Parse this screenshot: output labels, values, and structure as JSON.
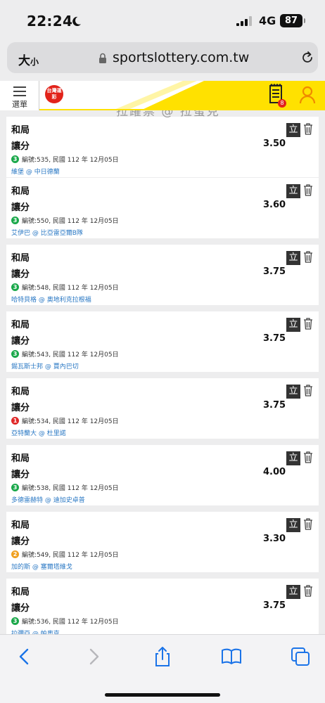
{
  "status_bar": {
    "time": "22:24",
    "network": "4G",
    "battery": "87"
  },
  "address_bar": {
    "text_size_big": "大",
    "text_size_small": "小",
    "url": "sportslottery.com.tw"
  },
  "header": {
    "menu_label": "選單",
    "logo_text": "台灣運彩",
    "bets_count": "8",
    "page_title_peek": "拉躍票 @ 拉蜜克"
  },
  "colors": {
    "accent_yellow": "#ffe100",
    "brand_red": "#e2231a",
    "link_blue": "#2a78c4",
    "badge_green": "#1aa84a",
    "badge_red": "#e02929",
    "badge_orange": "#f0a020"
  },
  "cards": [
    {
      "title": "和局",
      "bet_type": "讓分",
      "odds": "3.50",
      "badge": "3",
      "badge_color": "green",
      "meta": "編號:535, 民國 112 年 12月05日",
      "match": "維堡 @ 中日德蘭",
      "stand_label": "立"
    },
    {
      "title": "和局",
      "bet_type": "讓分",
      "odds": "3.60",
      "badge": "3",
      "badge_color": "green",
      "meta": "編號:550, 民國 112 年 12月05日",
      "match": "艾伊巴 @ 比亞雷亞爾B隊",
      "stand_label": "立"
    },
    {
      "title": "和局",
      "bet_type": "讓分",
      "odds": "3.75",
      "badge": "3",
      "badge_color": "green",
      "meta": "編號:548, 民國 112 年 12月05日",
      "match": "哈特貝格 @ 奧地利克拉根福",
      "stand_label": "立"
    },
    {
      "title": "和局",
      "bet_type": "讓分",
      "odds": "3.75",
      "badge": "3",
      "badge_color": "green",
      "meta": "編號:543, 民國 112 年 12月05日",
      "match": "錫瓦斯士邦 @ 賈內巴切",
      "stand_label": "立"
    },
    {
      "title": "和局",
      "bet_type": "讓分",
      "odds": "3.75",
      "badge": "1",
      "badge_color": "red",
      "meta": "編號:534, 民國 112 年 12月05日",
      "match": "亞特蘭大 @ 杜里諾",
      "stand_label": "立"
    },
    {
      "title": "和局",
      "bet_type": "讓分",
      "odds": "4.00",
      "badge": "3",
      "badge_color": "green",
      "meta": "編號:538, 民國 112 年 12月05日",
      "match": "多德雷赫特 @ 迪加史卓普",
      "stand_label": "立"
    },
    {
      "title": "和局",
      "bet_type": "讓分",
      "odds": "3.30",
      "badge": "2",
      "badge_color": "orange",
      "meta": "編號:549, 民國 112 年 12月05日",
      "match": "加的斯 @ 塞爾塔維戈",
      "stand_label": "立"
    },
    {
      "title": "和局",
      "bet_type": "讓分",
      "odds": "3.75",
      "badge": "3",
      "badge_color": "green",
      "meta": "編號:536, 民國 112 年 12月05日",
      "match": "拉彌亞 @ 帕奧克",
      "stand_label": "立"
    }
  ],
  "toolbar": {
    "icons": [
      "back-icon",
      "forward-icon",
      "share-icon",
      "bookmarks-icon",
      "tabs-icon"
    ]
  }
}
